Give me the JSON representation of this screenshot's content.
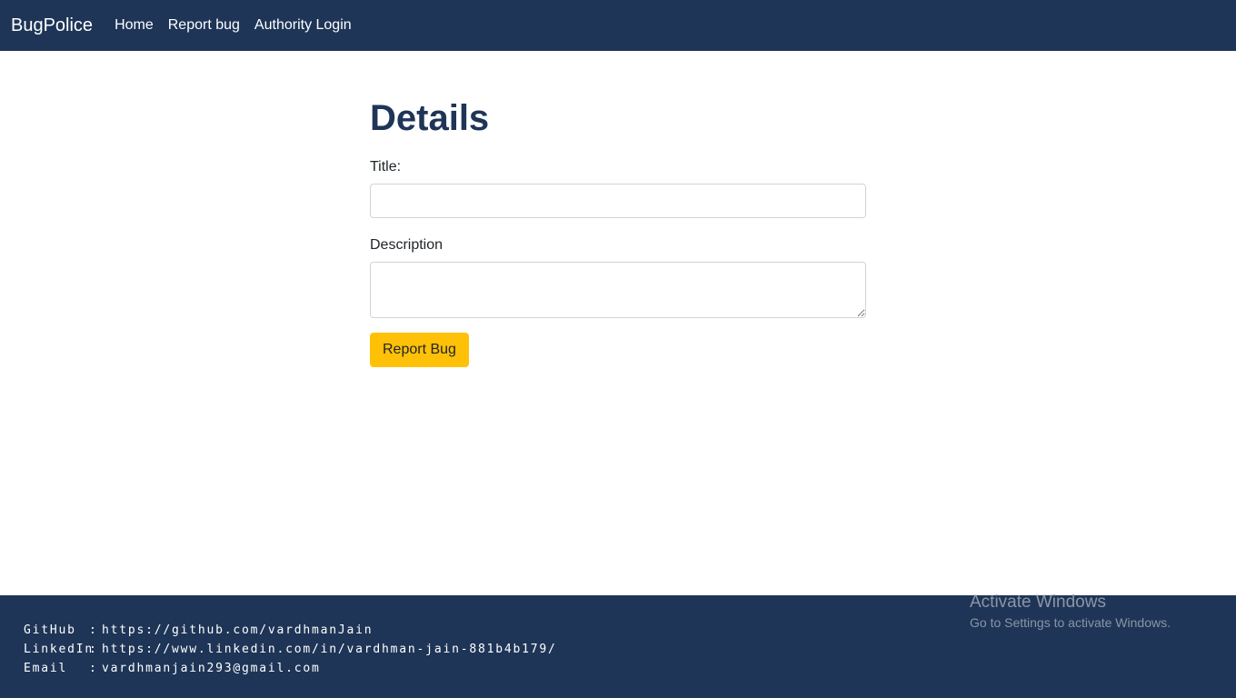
{
  "navbar": {
    "brand": "BugPolice",
    "links": [
      "Home",
      "Report bug",
      "Authority Login"
    ]
  },
  "form": {
    "heading": "Details",
    "title_label": "Title:",
    "title_value": "",
    "description_label": "Description",
    "description_value": "",
    "submit_label": "Report Bug"
  },
  "footer": {
    "rows": [
      {
        "key": "GitHub",
        "sep": ":",
        "value": "https://github.com/vardhmanJain"
      },
      {
        "key": "LinkedIn",
        "sep": ":",
        "value": "https://www.linkedin.com/in/vardhman-jain-881b4b179/"
      },
      {
        "key": "Email",
        "sep": ":",
        "value": "vardhmanjain293@gmail.com"
      }
    ]
  },
  "watermark": {
    "title": "Activate Windows",
    "subtitle": "Go to Settings to activate Windows."
  },
  "colors": {
    "navbar_bg": "#1e3557",
    "accent_button": "#ffc107",
    "heading": "#1e3557"
  }
}
